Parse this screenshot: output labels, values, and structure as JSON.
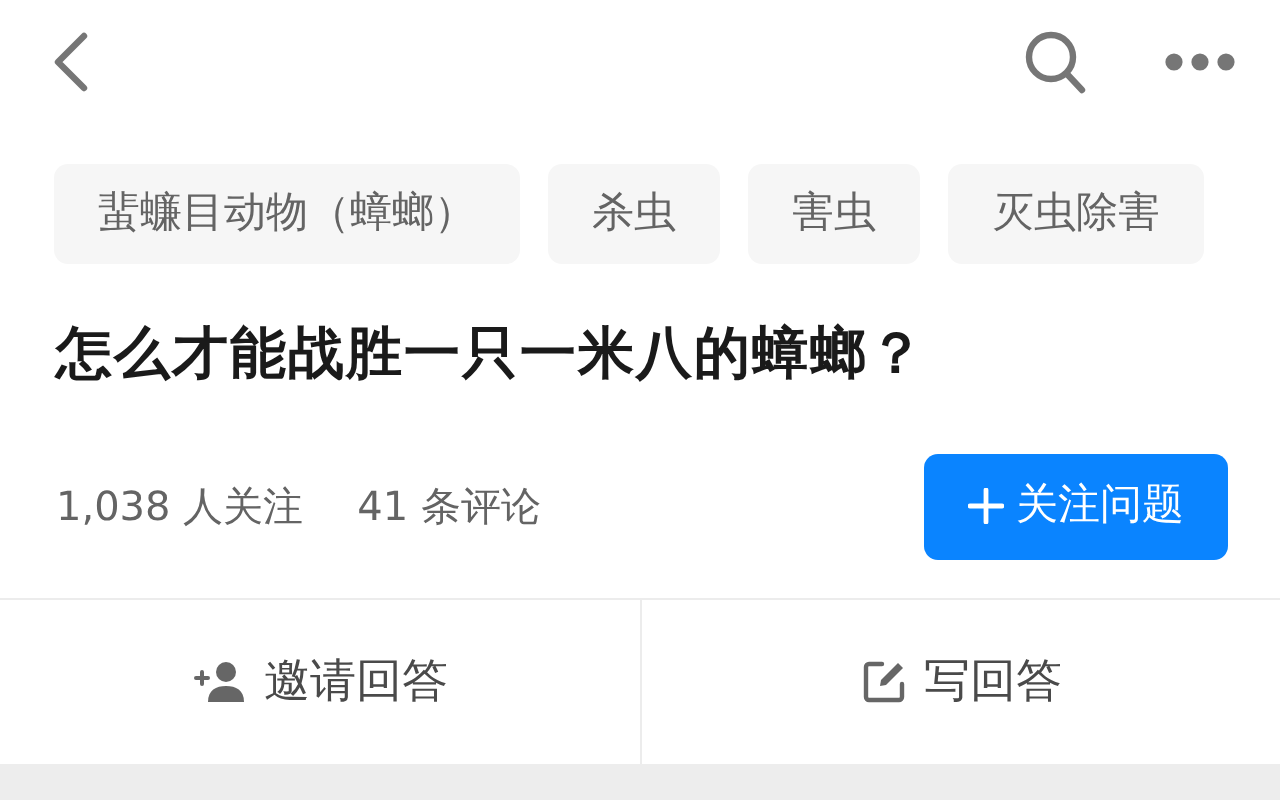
{
  "topics": [
    {
      "label": "蜚蠊目动物（蟑螂）"
    },
    {
      "label": "杀虫"
    },
    {
      "label": "害虫"
    },
    {
      "label": "灭虫除害"
    }
  ],
  "question": {
    "title": "怎么才能战胜一只一米八的蟑螂？"
  },
  "stats": {
    "followers": "1,038 人关注",
    "comments": "41 条评论"
  },
  "follow_button": {
    "label": "关注问题"
  },
  "actions": [
    {
      "kind": "invite",
      "label": "邀请回答"
    },
    {
      "kind": "write",
      "label": "写回答"
    }
  ]
}
